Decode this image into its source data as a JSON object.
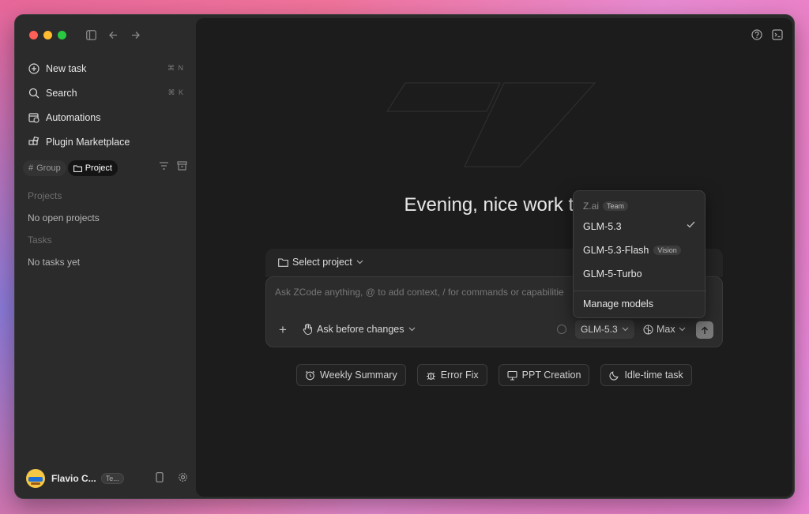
{
  "sidebar": {
    "nav": [
      {
        "label": "New task",
        "shortcut": "⌘ N",
        "icon": "new-task-icon"
      },
      {
        "label": "Search",
        "shortcut": "⌘ K",
        "icon": "search-icon"
      },
      {
        "label": "Automations",
        "shortcut": "",
        "icon": "calendar-clock-icon"
      },
      {
        "label": "Plugin Marketplace",
        "shortcut": "",
        "icon": "plugin-icon"
      }
    ],
    "filters": {
      "group": "Group",
      "project": "Project",
      "active": "Project"
    },
    "projects_title": "Projects",
    "projects_empty": "No open projects",
    "tasks_title": "Tasks",
    "tasks_empty": "No tasks yet",
    "user": {
      "name": "Flavio C...",
      "badge": "Te..."
    }
  },
  "main": {
    "greeting": "Evening, nice work to",
    "select_project": "Select project",
    "placeholder": "Ask ZCode anything, @ to add context, / for commands or capabilitie",
    "ask_mode": "Ask before changes",
    "model": "GLM-5.3",
    "effort": "Max",
    "chips": [
      {
        "label": "Weekly Summary",
        "icon": "alarm-clock-icon"
      },
      {
        "label": "Error Fix",
        "icon": "bug-icon"
      },
      {
        "label": "PPT Creation",
        "icon": "presentation-icon"
      },
      {
        "label": "Idle-time task",
        "icon": "moon-icon"
      }
    ]
  },
  "model_menu": {
    "provider": "Z.ai",
    "provider_tag": "Team",
    "items": [
      {
        "label": "GLM-5.3",
        "tag": "",
        "selected": true
      },
      {
        "label": "GLM-5.3-Flash",
        "tag": "Vision",
        "selected": false
      },
      {
        "label": "GLM-5-Turbo",
        "tag": "",
        "selected": false
      }
    ],
    "manage": "Manage models"
  },
  "colors": {
    "accent_send": "#7a7a7a",
    "sidebar_bg": "#2b2b2b",
    "main_bg": "#1c1c1c"
  }
}
